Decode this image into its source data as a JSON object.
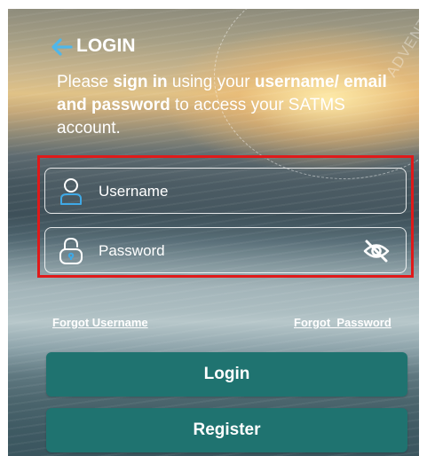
{
  "header": {
    "title": "LOGIN",
    "back_icon": "arrow-left-icon",
    "accent_color": "#4fb7ea"
  },
  "intro": {
    "part1": "Please ",
    "bold1": "sign in",
    "part2": " using your ",
    "bold2": "username/ email and password",
    "part3": " to access your SATMS account."
  },
  "background": {
    "stamp_text": "ADVENTU"
  },
  "form": {
    "username": {
      "placeholder": "Username",
      "value": "",
      "icon": "user-icon"
    },
    "password": {
      "placeholder": "Password",
      "value": "",
      "icon": "lock-icon",
      "toggle_icon": "eye-off-icon"
    },
    "highlight_color": "#e01a1a"
  },
  "links": {
    "forgot_username": "Forgot Username",
    "forgot_password": "Forgot  Password"
  },
  "buttons": {
    "login": "Login",
    "register": "Register",
    "color": "#1f7370"
  }
}
